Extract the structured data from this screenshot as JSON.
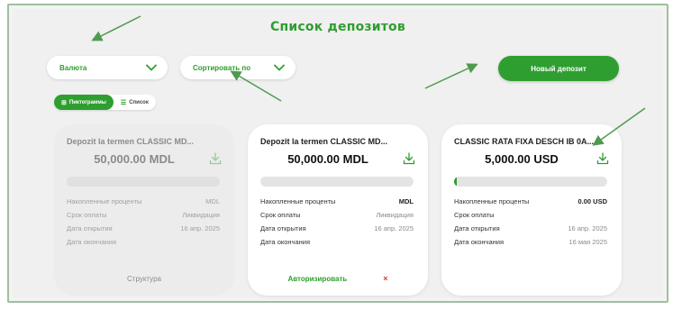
{
  "header": {
    "title": "Список депозитов"
  },
  "filters": {
    "currency_label": "Валюта",
    "sort_label": "Сортировать по"
  },
  "actions": {
    "new_deposit": "Новый депозит"
  },
  "view_toggle": {
    "tiles": "Пиктограммы",
    "list": "Список",
    "active": "tiles"
  },
  "colors": {
    "accent": "#2f9e30",
    "danger": "#d23a3a"
  },
  "deposits": [
    {
      "title": "Depozit la termen CLASSIC MD...",
      "amount": "50,000.00 MDL",
      "progress": 0,
      "rows": [
        {
          "label": "Накопленные проценты",
          "value": "MDL"
        },
        {
          "label": "Срок оплаты",
          "value": "Ликвидация"
        },
        {
          "label": "Дата открытия",
          "value": "16 апр. 2025"
        },
        {
          "label": "Дата окончания",
          "value": ""
        }
      ],
      "footer": {
        "link": "Структура"
      }
    },
    {
      "title": "Depozit la termen CLASSIC MD...",
      "amount": "50,000.00 MDL",
      "progress": 0,
      "rows": [
        {
          "label": "Накопленные проценты",
          "value": "MDL"
        },
        {
          "label": "Срок оплаты",
          "value": "Ликвидация"
        },
        {
          "label": "Дата открытия",
          "value": "16 апр. 2025"
        },
        {
          "label": "Дата окончания",
          "value": ""
        }
      ],
      "footer": {
        "authorize": "Авторизировать",
        "cancel": "×"
      }
    },
    {
      "title": "CLASSIC RATA FIXA DESCH IB 0A...",
      "amount": "5,000.00 USD",
      "progress": 0.01,
      "rows": [
        {
          "label": "Накопленные проценты",
          "value": "0.00 USD"
        },
        {
          "label": "Срок оплаты",
          "value": ""
        },
        {
          "label": "Дата открытия",
          "value": "16 апр. 2025"
        },
        {
          "label": "Дата окончания",
          "value": "16 мая 2025"
        }
      ],
      "footer": {}
    }
  ]
}
